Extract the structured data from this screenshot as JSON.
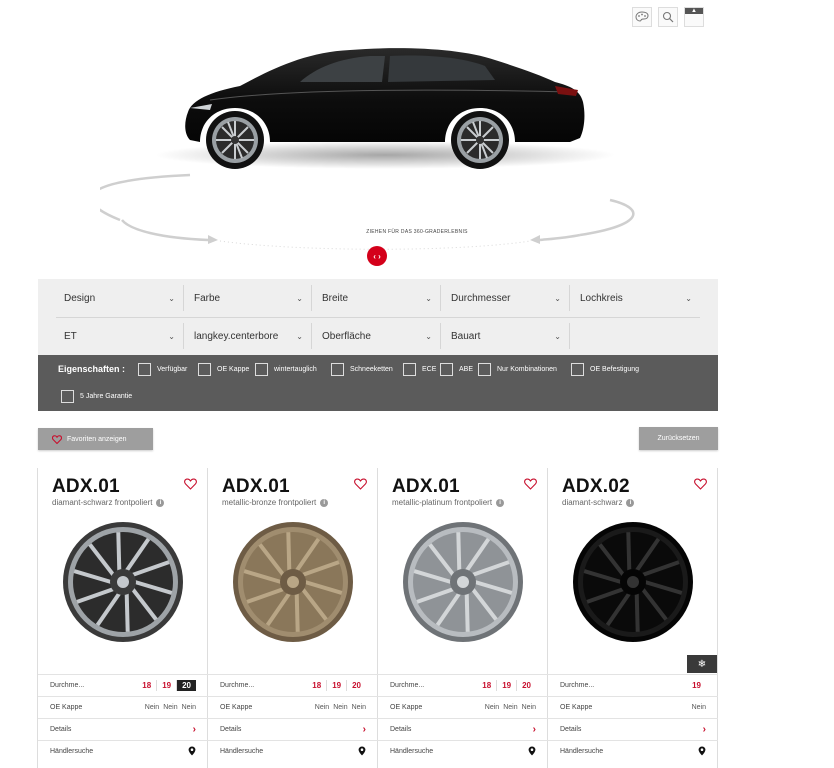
{
  "top_icons": [
    "color-palette-icon",
    "search-icon",
    "collapse-icon"
  ],
  "stage": {
    "drag_hint": "ZIEHEN FÜR DAS 360-GRADERLEBNIS",
    "rotate_glyph": "‹ ›"
  },
  "filters": {
    "row1": [
      "Design",
      "Farbe",
      "Breite",
      "Durchmesser",
      "Lochkreis"
    ],
    "row2": [
      "ET",
      "langkey.centerbore",
      "Oberfläche",
      "Bauart"
    ]
  },
  "properties": {
    "title": "Eigenschaften :",
    "items": [
      "Verfügbar",
      "OE Kappe",
      "wintertauglich",
      "Schneeketten",
      "ECE",
      "ABE",
      "Nur Kombinationen",
      "OE Befestigung",
      "5 Jahre Garantie"
    ]
  },
  "buttons": {
    "favorites": "Favoriten anzeigen",
    "reset": "Zurücksetzen"
  },
  "labels": {
    "diameter": "Durchme...",
    "oe_cap": "OE Kappe",
    "details": "Details",
    "dealer": "Händlersuche"
  },
  "cards": [
    {
      "title": "ADX.01",
      "subtitle": "diamant-schwarz frontpoliert",
      "finish": "dark-polished",
      "sizes": [
        "18",
        "19",
        "20"
      ],
      "active_size": "20",
      "oe_values": [
        "Nein",
        "Nein",
        "Nein"
      ],
      "winter": false
    },
    {
      "title": "ADX.01",
      "subtitle": "metallic-bronze frontpoliert",
      "finish": "bronze",
      "sizes": [
        "18",
        "19",
        "20"
      ],
      "active_size": "",
      "oe_values": [
        "Nein",
        "Nein",
        "Nein"
      ],
      "winter": false
    },
    {
      "title": "ADX.01",
      "subtitle": "metallic-platinum frontpoliert",
      "finish": "silver",
      "sizes": [
        "18",
        "19",
        "20"
      ],
      "active_size": "",
      "oe_values": [
        "Nein",
        "Nein",
        "Nein"
      ],
      "winter": false
    },
    {
      "title": "ADX.02",
      "subtitle": "diamant-schwarz",
      "finish": "black",
      "sizes": [
        "19"
      ],
      "active_size": "",
      "oe_values": [
        "Nein"
      ],
      "winter": true
    }
  ],
  "colors": {
    "accent": "#c8102e",
    "props_bg": "#5b5b5b",
    "filter_bg": "#efefef"
  }
}
